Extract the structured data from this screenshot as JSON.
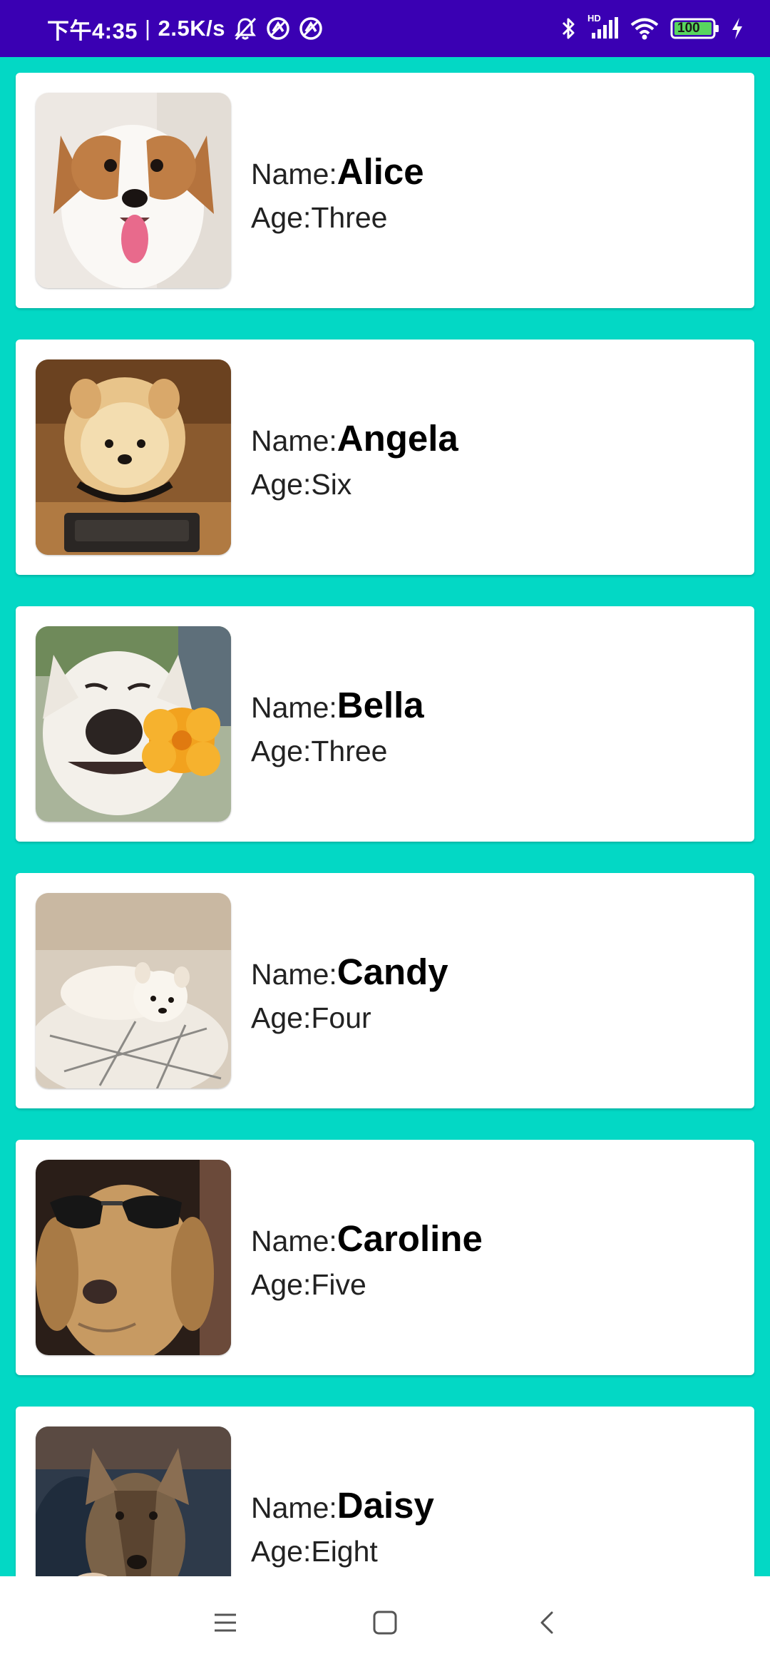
{
  "status_bar": {
    "time": "下午4:35",
    "separator": "|",
    "net_speed": "2.5K/s",
    "battery": "100",
    "network_label": "HD",
    "icons": [
      "mute-icon",
      "sync-icon",
      "sync-icon",
      "bluetooth-icon",
      "signal-icon",
      "wifi-icon",
      "battery-icon",
      "charging-icon"
    ]
  },
  "colors": {
    "status_bar": "#3A00B3",
    "list_background": "#03D8C5",
    "card": "#FFFFFF"
  },
  "dogs": [
    {
      "name_label": "Name:",
      "name": "Alice",
      "age_label": "Age:",
      "age": "Three"
    },
    {
      "name_label": "Name:",
      "name": "Angela",
      "age_label": "Age:",
      "age": "Six"
    },
    {
      "name_label": "Name:",
      "name": "Bella",
      "age_label": "Age:",
      "age": "Three"
    },
    {
      "name_label": "Name:",
      "name": "Candy",
      "age_label": "Age:",
      "age": "Four"
    },
    {
      "name_label": "Name:",
      "name": "Caroline",
      "age_label": "Age:",
      "age": "Five"
    },
    {
      "name_label": "Name:",
      "name": "Daisy",
      "age_label": "Age:",
      "age": "Eight"
    }
  ],
  "nav_bar": {
    "items": [
      "menu-icon",
      "home-icon",
      "back-icon"
    ]
  }
}
